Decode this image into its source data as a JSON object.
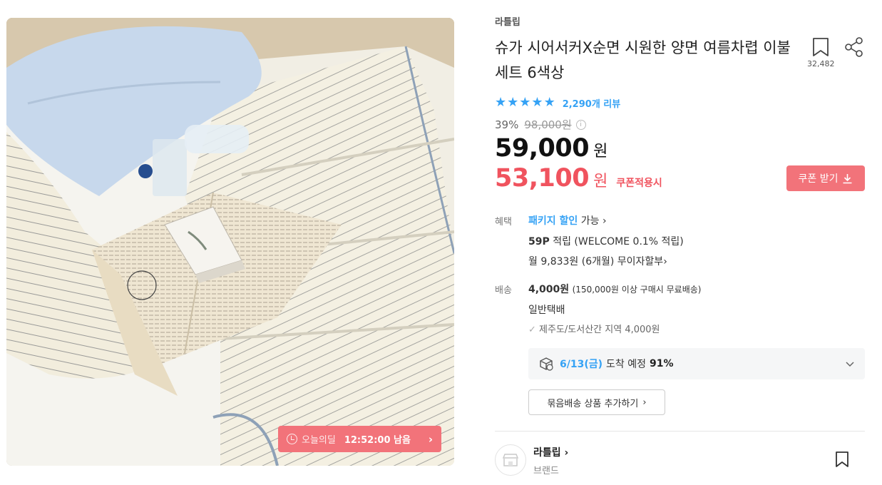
{
  "product": {
    "brand": "라틀립",
    "title": "슈가 시어서커X순면 시원한 양면 여름차렵 이불 세트 6색상",
    "bookmark_count": "32,482",
    "rating_stars": 5,
    "reviews": "2,290개 리뷰",
    "discount_pct": "39%",
    "original_price": "98,000원",
    "price": "59,000",
    "price_unit": "원",
    "coupon_price": "53,100",
    "coupon_unit": "원",
    "coupon_tag": "쿠폰적용시",
    "coupon_button": "쿠폰 받기"
  },
  "deal": {
    "label": "오늘의딜",
    "timer": "12:52:00 남음"
  },
  "benefits": {
    "label": "혜택",
    "package_link": "패키지 할인",
    "package_suffix": "가능",
    "points_bold": "59P",
    "points_text": "적립 (WELCOME 0.1% 적립)",
    "installment": "월 9,833원 (6개월) 무이자할부"
  },
  "shipping": {
    "label": "배송",
    "fee": "4,000원",
    "fee_note": "(150,000원 이상 구매시 무료배송)",
    "method": "일반택배",
    "extra_region": "제주도/도서산간 지역 4,000원",
    "arrival_date": "6/13(금)",
    "arrival_text": "도착 예정",
    "arrival_pct": "91%",
    "bundle_button": "묶음배송 상품 추가하기"
  },
  "seller": {
    "name": "라틀립",
    "type": "브랜드"
  },
  "icons": {
    "bookmark": "bookmark-icon",
    "share": "share-icon",
    "star": "star-icon",
    "download": "download-icon",
    "clock": "clock-icon",
    "truck": "delivery-box-icon",
    "chevron": "chevron-icon",
    "store": "store-icon"
  },
  "colors": {
    "accent_blue": "#35a2f5",
    "coupon_red": "#f0535e",
    "badge_pink": "#f2737a"
  }
}
